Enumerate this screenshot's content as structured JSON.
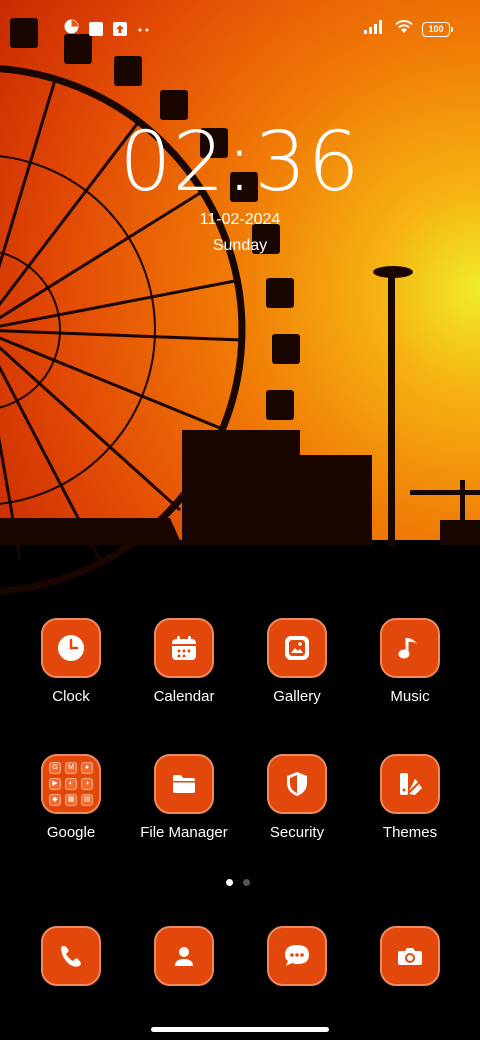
{
  "status_bar": {
    "battery": "100",
    "notification_icons": [
      "app-notification-icon",
      "square-notification-icon",
      "upload-icon",
      "more-dots-icon"
    ],
    "system_icons": [
      "signal-icon",
      "wifi-icon",
      "battery-icon"
    ]
  },
  "lockclock": {
    "time": "02:36",
    "date": "11-02-2024",
    "day": "Sunday"
  },
  "apps": {
    "clock": "Clock",
    "calendar": "Calendar",
    "gallery": "Gallery",
    "music": "Music",
    "google": "Google",
    "file_manager": "File Manager",
    "security": "Security",
    "themes": "Themes"
  },
  "google_folder": [
    "G",
    "M",
    "●",
    "▶",
    "◐",
    "◑",
    "◆",
    "▦",
    "▤"
  ],
  "dock": [
    "phone-icon",
    "contacts-icon",
    "messages-icon",
    "camera-icon"
  ],
  "pages": {
    "total": 2,
    "current": 1
  },
  "colors": {
    "accent": "#e2470c",
    "accent_border": "#f08a5d"
  }
}
